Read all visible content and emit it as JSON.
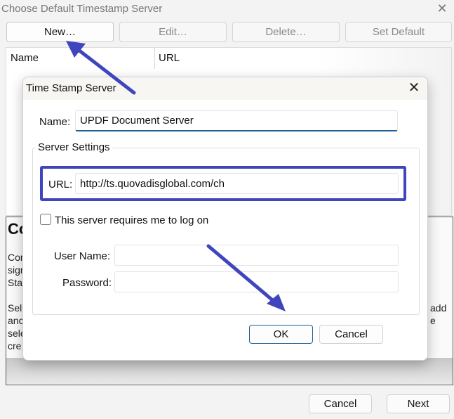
{
  "window": {
    "title": "Choose Default Timestamp Server",
    "close_icon": "close-icon"
  },
  "toolbar": {
    "new_label": "New…",
    "edit_label": "Edit…",
    "delete_label": "Delete…",
    "set_default_label": "Set Default"
  },
  "server_list": {
    "columns": [
      "Name",
      "URL"
    ]
  },
  "description": {
    "heading": "Co",
    "lines_left": [
      "Cor",
      "sigr",
      "Sta",
      "",
      "Sele",
      "anc",
      "sele",
      "cre"
    ],
    "lines_right": [
      "add",
      "e"
    ]
  },
  "footer": {
    "cancel_label": "Cancel",
    "next_label": "Next"
  },
  "dialog": {
    "title": "Time Stamp Server",
    "name_label": "Name:",
    "name_value": "UPDF Document Server",
    "group_label": "Server Settings",
    "url_label": "URL:",
    "url_value": "http://ts.quovadisglobal.com/ch",
    "login_checkbox_label": "This server requires me to log on",
    "login_checked": false,
    "username_label": "User Name:",
    "username_value": "",
    "password_label": "Password:",
    "password_value": "",
    "ok_label": "OK",
    "cancel_label": "Cancel"
  },
  "annotations": {
    "arrow_color": "#3f45bd",
    "highlight_color": "#3f45bd"
  }
}
